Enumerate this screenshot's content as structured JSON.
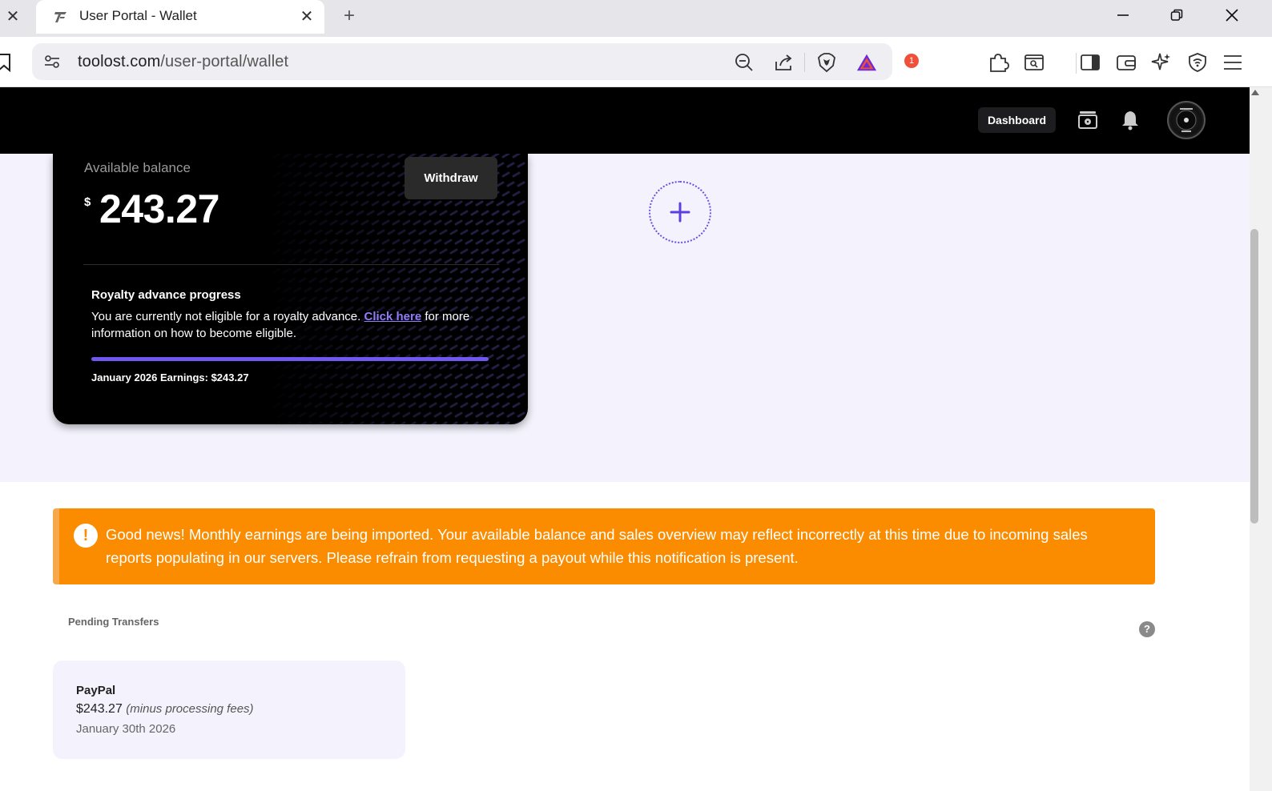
{
  "browser": {
    "tab_title": "User Portal - Wallet",
    "url_host": "toolost.com",
    "url_path": "/user-portal/wallet",
    "notification_count": "1"
  },
  "header": {
    "dashboard_label": "Dashboard"
  },
  "wallet": {
    "available_label": "Available balance",
    "currency_symbol": "$",
    "balance": "243.27",
    "withdraw_label": "Withdraw",
    "advance_title": "Royalty advance progress",
    "advance_text_before": "You are currently not eligible for a royalty advance.",
    "advance_link": "Click here",
    "advance_text_after": "for more information on how to become eligible.",
    "advance_progress": 1.0,
    "earnings_label": "January 2026 Earnings: $243.27"
  },
  "alert": {
    "icon": "!",
    "text": "Good news! Monthly earnings are being imported. Your available balance and sales overview may reflect incorrectly at this time due to incoming sales reports populating in our servers. Please refrain from requesting a payout while this notification is present."
  },
  "pending": {
    "label": "Pending Transfers",
    "help": "?",
    "transfers": [
      {
        "method": "PayPal",
        "amount": "$243.27",
        "fees_note": "(minus processing fees)",
        "date": "January 30th 2026"
      }
    ]
  },
  "colors": {
    "accent": "#7256f0",
    "alert": "#fb8c00",
    "header": "#000000",
    "lavender": "#f4f3fd"
  }
}
